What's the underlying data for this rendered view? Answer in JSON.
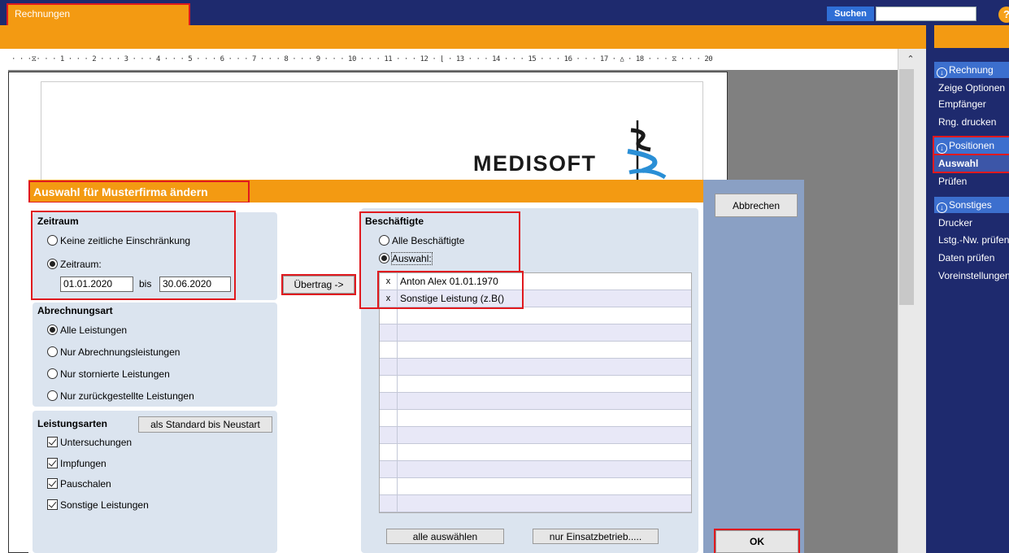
{
  "app": {
    "title": "Rechnungen",
    "search_label": "Suchen",
    "search_value": "",
    "help_icon": "help-icon"
  },
  "ruler": {
    "text": "· · ·⧖· · · 1 · · · 2 · · · 3 · · · 4 · · · 5 · · · 6 · · · 7 · · · 8 · · · 9 · · · 10 · · · 11 · · · 12 · ⌊ · 13 · · · 14 · · · 15 · · · 16 · · · 17 · ⩟ · 18 · · · ⧖ · · · 20"
  },
  "document": {
    "logo_text": "MEDISOFT"
  },
  "side": {
    "sections": [
      {
        "head": "Rechnung",
        "items": [
          "Zeige Optionen",
          "Empfänger",
          "Rng. drucken"
        ]
      },
      {
        "head": "Positionen",
        "items": [
          "Auswahl",
          "Prüfen"
        ]
      },
      {
        "head": "Sonstiges",
        "items": [
          "Drucker",
          "Lstg.-Nw. prüfen",
          "Daten prüfen",
          "Voreinstellungen"
        ]
      }
    ]
  },
  "dialog": {
    "title": "Auswahl für Musterfirma ändern",
    "cancel_label": "Abbrechen",
    "ok_label": "OK",
    "zeitraum": {
      "title": "Zeitraum",
      "opt_none": "Keine zeitliche Einschränkung",
      "opt_range": "Zeitraum:",
      "from": "01.01.2020",
      "bis": "bis",
      "to": "30.06.2020"
    },
    "abrechnungsart": {
      "title": "Abrechnungsart",
      "options": [
        "Alle Leistungen",
        "Nur Abrechnungsleistungen",
        "Nur stornierte Leistungen",
        "Nur zurückgestellte Leistungen"
      ]
    },
    "leistungsarten": {
      "title": "Leistungsarten",
      "standard_button": "als Standard bis Neustart",
      "options": [
        "Untersuchungen",
        "Impfungen",
        "Pauschalen",
        "Sonstige Leistungen"
      ]
    },
    "uebertrag_label": "Übertrag ->",
    "beschaeftigte": {
      "title": "Beschäftigte",
      "opt_all": "Alle Beschäftigte",
      "opt_select": "Auswahl:",
      "rows": [
        {
          "mark": "x",
          "text": "Anton Alex  01.01.1970"
        },
        {
          "mark": "x",
          "text": "Sonstige Leistung (z.B()"
        }
      ],
      "select_all_label": "alle auswählen",
      "einsatz_label": "nur Einsatzbetrieb....."
    }
  },
  "colors": {
    "navy": "#1e2a6e",
    "orange": "#f39a12",
    "highlight_red": "#e0191e",
    "dialog_blue": "#8aa0c4",
    "group_bg": "#dbe4ef"
  }
}
